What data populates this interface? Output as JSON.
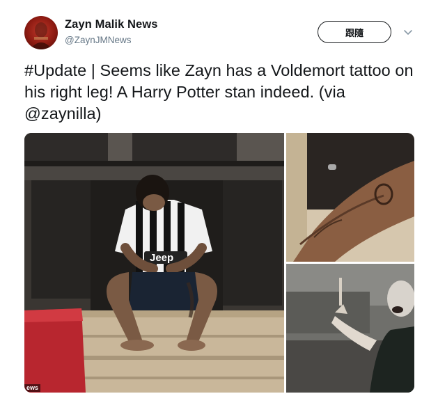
{
  "account": {
    "display_name": "Zayn Malik News",
    "handle": "@ZaynJMNews"
  },
  "follow_label": "跟隨",
  "tweet_text": "#Update | Seems like Zayn has a Voldemort tattoo on his right leg! A Harry Potter stan indeed. (via @zaynilla)",
  "media": {
    "main": {
      "shirt_text": "Jeep",
      "watermark": "ews"
    },
    "top_right": {},
    "bottom_right": {}
  },
  "icons": {
    "avatar": "avatar-image",
    "caret": "chevron-down-icon"
  }
}
